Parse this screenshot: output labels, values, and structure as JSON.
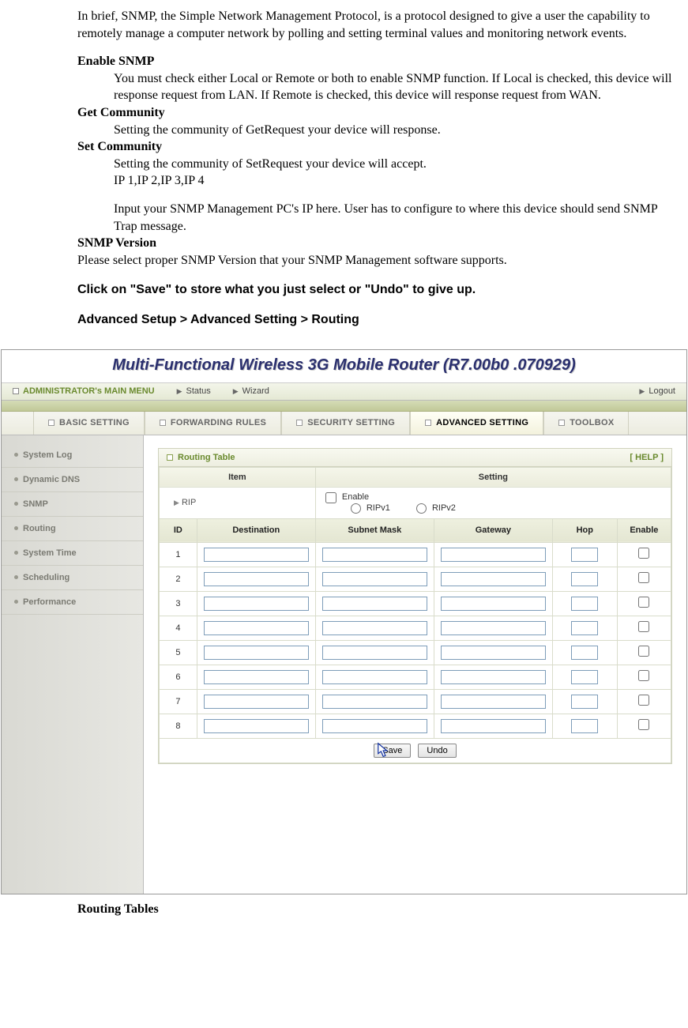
{
  "doc": {
    "intro": "In brief, SNMP, the Simple Network Management Protocol, is a protocol designed to give a user the capability to remotely manage a computer network by polling and setting terminal values and monitoring network events.",
    "enable_snmp_term": "Enable SNMP",
    "enable_snmp_desc": "You must check either Local or Remote or both to enable SNMP function. If Local is checked, this device will response request from LAN. If Remote is checked, this device will response request from WAN.",
    "get_community_term": "Get Community",
    "get_community_desc": "Setting the community of GetRequest your device will response.",
    "set_community_term": "Set Community",
    "set_community_desc1": "Setting the community of SetRequest your device will accept.",
    "set_community_desc2": "IP 1,IP 2,IP 3,IP 4",
    "set_community_desc3": "Input your SNMP Management PC's IP here. User has to configure to where this device should send SNMP Trap message.",
    "snmp_version_term": "SNMP Version",
    "snmp_version_desc": "Please select proper SNMP Version that your SNMP Management software supports.",
    "save_note": "Click on \"Save\" to store what you just select or \"Undo\" to give up.",
    "breadcrumb": "Advanced Setup > Advanced Setting > Routing",
    "footer": "Routing Tables"
  },
  "router": {
    "title": "Multi-Functional Wireless 3G Mobile Router (R7.00b0 .070929)",
    "menu1": {
      "main": "ADMINISTRATOR's MAIN MENU",
      "status": "Status",
      "wizard": "Wizard",
      "logout": "Logout"
    },
    "tabs": [
      "BASIC SETTING",
      "FORWARDING RULES",
      "SECURITY SETTING",
      "ADVANCED SETTING",
      "TOOLBOX"
    ],
    "active_tab_index": 3,
    "sidebar": [
      "System Log",
      "Dynamic DNS",
      "SNMP",
      "Routing",
      "System Time",
      "Scheduling",
      "Performance"
    ],
    "panel": {
      "title": "Routing Table",
      "help": "[ HELP ]",
      "head_item": "Item",
      "head_setting": "Setting",
      "rip_label": "RIP",
      "enable_label": "Enable",
      "ripv1_label": "RIPv1",
      "ripv2_label": "RIPv2",
      "cols": {
        "id": "ID",
        "dest": "Destination",
        "mask": "Subnet Mask",
        "gw": "Gateway",
        "hop": "Hop",
        "enable": "Enable"
      },
      "rows": [
        1,
        2,
        3,
        4,
        5,
        6,
        7,
        8
      ],
      "save_btn": "Save",
      "undo_btn": "Undo"
    }
  }
}
